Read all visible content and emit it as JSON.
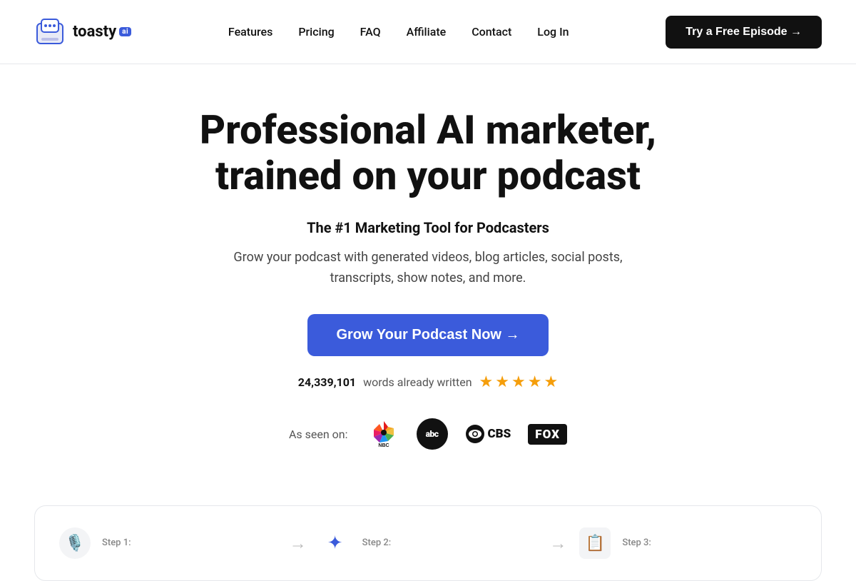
{
  "logo": {
    "name": "toasty",
    "ai_badge": "ai",
    "alt": "Toasty AI Logo"
  },
  "nav": {
    "links": [
      {
        "label": "Features",
        "href": "#"
      },
      {
        "label": "Pricing",
        "href": "#"
      },
      {
        "label": "FAQ",
        "href": "#"
      },
      {
        "label": "Affiliate",
        "href": "#"
      },
      {
        "label": "Contact",
        "href": "#"
      },
      {
        "label": "Log In",
        "href": "#"
      }
    ],
    "cta": {
      "label": "Try a Free Episode →"
    }
  },
  "hero": {
    "title_line1": "Professional AI marketer,",
    "title_line2": "trained on your podcast",
    "subtitle": "The #1 Marketing Tool for Podcasters",
    "description": "Grow your podcast with generated videos, blog articles, social posts, transcripts, show notes, and more.",
    "cta_label": "Grow Your Podcast Now →",
    "words_count": "24,339,101",
    "words_suffix": "words already written",
    "stars_count": 5
  },
  "as_seen_on": {
    "label": "As seen on:",
    "logos": [
      "NBC",
      "abc",
      "CBS",
      "FOX"
    ]
  },
  "steps": [
    {
      "label": "Step 1:",
      "icon": "podcast-icon"
    },
    {
      "label": "Step 2:",
      "icon": "sparkle-icon"
    },
    {
      "label": "Step 3:",
      "icon": "clipboard-icon"
    }
  ],
  "colors": {
    "accent": "#3b5bdb",
    "dark": "#111111",
    "star": "#f59e0b",
    "border": "#e5e7eb"
  }
}
